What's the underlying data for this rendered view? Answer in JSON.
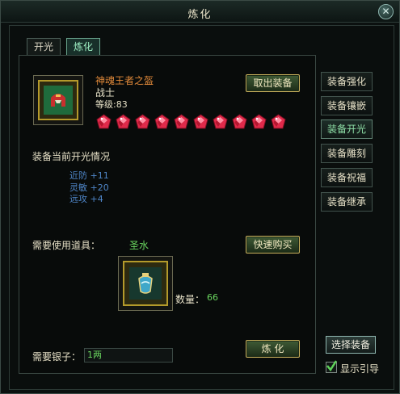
{
  "window": {
    "title": "炼化",
    "close_glyph": "✕"
  },
  "tabs": [
    {
      "label": "开光",
      "active": false
    },
    {
      "label": "炼化",
      "active": true
    }
  ],
  "equipment": {
    "name": "神魂王者之盔",
    "class": "战士",
    "level": "等级:83",
    "remove_button": "取出装备",
    "gem_count": 10
  },
  "status": {
    "section_title": "装备当前开光情况",
    "stats": [
      "近防  +11",
      "灵敏  +20",
      "远攻  +4"
    ]
  },
  "tool": {
    "label": "需要使用道具：",
    "name": "圣水",
    "quick_buy_button": "快速购买",
    "quantity_label": "数量：",
    "quantity_value": "66"
  },
  "silver": {
    "label": "需要银子：",
    "value": "1两"
  },
  "refine_button": "炼  化",
  "side_menu": [
    {
      "label": "装备强化",
      "active": false
    },
    {
      "label": "装备镶嵌",
      "active": false
    },
    {
      "label": "装备开光",
      "active": true
    },
    {
      "label": "装备雕刻",
      "active": false
    },
    {
      "label": "装备祝福",
      "active": false
    },
    {
      "label": "装备继承",
      "active": false
    }
  ],
  "select_equipment_button": "选择装备",
  "show_guide": {
    "label": "显示引导",
    "checked": true
  },
  "colors": {
    "gem_red": "#e02a4a",
    "highlight_green": "#6ad65f",
    "stat_blue": "#4f86c8",
    "item_name_orange": "#e28a3a"
  }
}
